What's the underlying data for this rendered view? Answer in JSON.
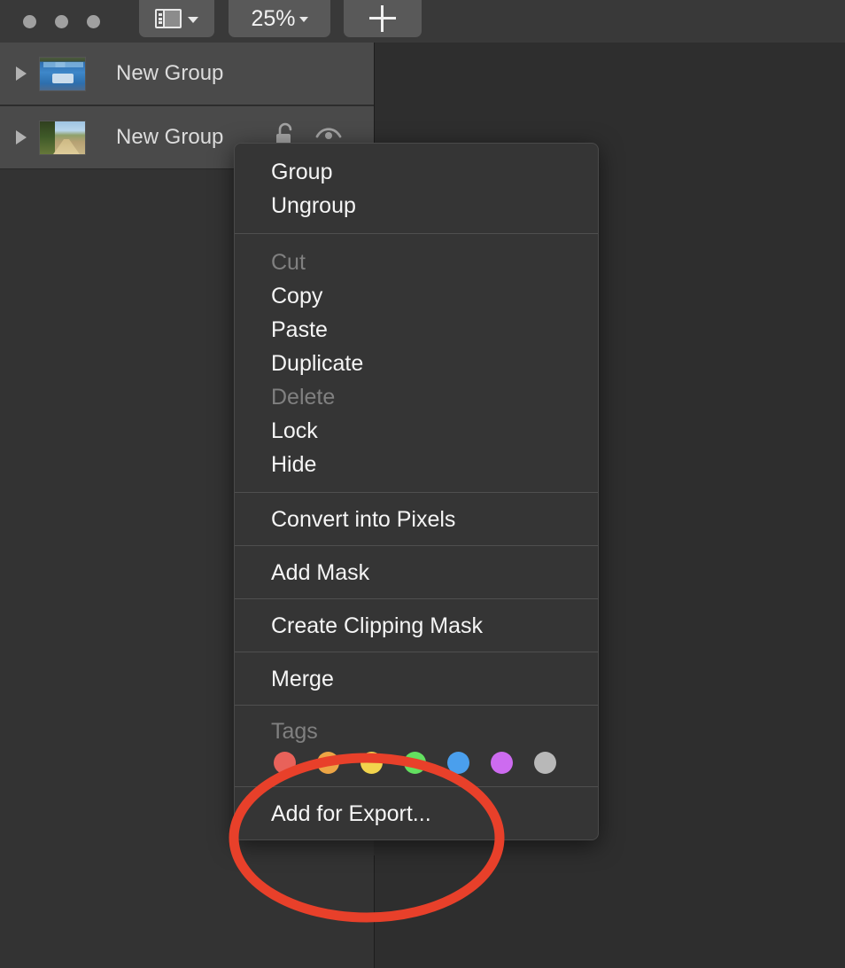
{
  "window": {
    "traffic_lights": [
      "close",
      "minimize",
      "zoom"
    ],
    "background_color": "#2e2e2e"
  },
  "toolbar": {
    "layout_button": {
      "icon": "sidebar-layout-icon",
      "chevron": "chevron-down-icon"
    },
    "zoom_button": {
      "value": "25%",
      "chevron": "chevron-down-icon"
    },
    "add_button": {
      "icon": "plus-icon"
    }
  },
  "sidebar": {
    "layers": [
      {
        "name": "New Group",
        "thumbnail": "screenshot-thumbnail",
        "disclosure": "disclosure-triangle-right",
        "selected": true
      },
      {
        "name": "New Group",
        "thumbnail": "landscape-photo-thumbnail",
        "disclosure": "disclosure-triangle-right",
        "selected": true,
        "lock_icon": "unlock-icon",
        "visibility_icon": "eye-icon"
      }
    ]
  },
  "context_menu": {
    "groups": [
      {
        "items": [
          {
            "label": "Group",
            "disabled": false
          },
          {
            "label": "Ungroup",
            "disabled": false
          }
        ]
      },
      {
        "items": [
          {
            "label": "Cut",
            "disabled": true
          },
          {
            "label": "Copy",
            "disabled": false
          },
          {
            "label": "Paste",
            "disabled": false
          },
          {
            "label": "Duplicate",
            "disabled": false
          },
          {
            "label": "Delete",
            "disabled": true
          },
          {
            "label": "Lock",
            "disabled": false
          },
          {
            "label": "Hide",
            "disabled": false
          }
        ]
      },
      {
        "items": [
          {
            "label": "Convert into Pixels",
            "disabled": false
          }
        ]
      },
      {
        "items": [
          {
            "label": "Add Mask",
            "disabled": false
          }
        ]
      },
      {
        "items": [
          {
            "label": "Create Clipping Mask",
            "disabled": false
          }
        ]
      },
      {
        "items": [
          {
            "label": "Merge",
            "disabled": false
          }
        ]
      }
    ],
    "tags": {
      "label": "Tags",
      "disabled": true,
      "colors": [
        "#e8625a",
        "#eda545",
        "#f2d44d",
        "#63e060",
        "#4a9fed",
        "#cd6bf0",
        "#b8b8b8"
      ]
    },
    "footer": {
      "label": "Add for Export...",
      "disabled": false
    }
  },
  "annotation": {
    "shape": "ellipse",
    "color": "#e8402a",
    "stroke_width": 11,
    "target": "Add for Export..."
  }
}
